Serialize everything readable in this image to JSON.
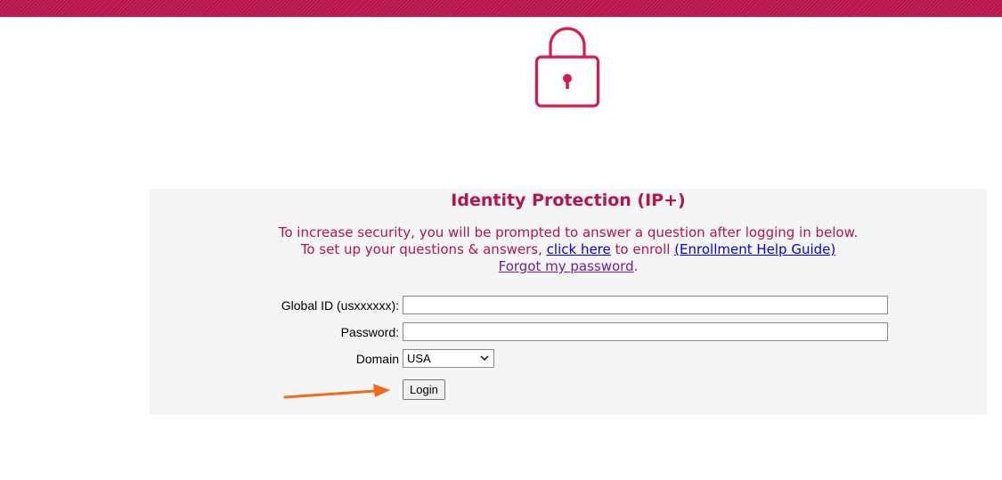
{
  "header": {
    "accent_color": "#b8144a",
    "lock_icon": "lock-icon"
  },
  "panel": {
    "title": "Identity Protection (IP+)",
    "line1": "To increase security, you will be prompted to answer a question after logging in below.",
    "line2_prefix": "To set up your questions & answers, ",
    "click_here_link": "click here",
    "line2_middle": " to enroll ",
    "enrollment_help_link": "(Enrollment Help Guide)",
    "forgot_password_link": "Forgot my password",
    "forgot_suffix": "."
  },
  "form": {
    "global_id_label": "Global ID (usxxxxxx):",
    "global_id_value": "",
    "password_label": "Password:",
    "password_value": "",
    "domain_label": "Domain",
    "domain_selected": "USA",
    "login_button": "Login"
  },
  "annotation": {
    "arrow_color": "#f26a1b"
  }
}
